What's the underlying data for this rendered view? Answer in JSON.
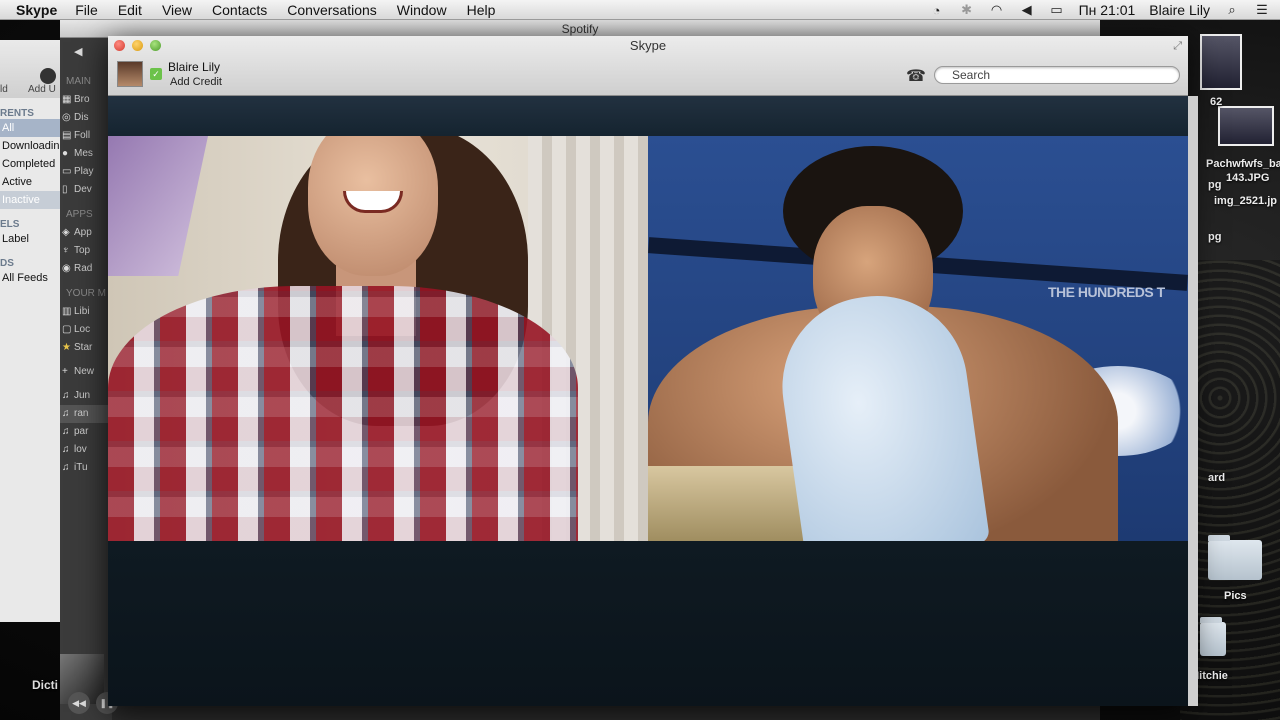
{
  "menubar": {
    "app": "Skype",
    "items": [
      "File",
      "Edit",
      "View",
      "Contacts",
      "Conversations",
      "Window",
      "Help"
    ],
    "clock": "Пн 21:01",
    "user": "Blaire Lily"
  },
  "torrent": {
    "toolbar_add": "Add U",
    "toolbar_d": "ld",
    "sections": {
      "torrents": "RENTS",
      "labels": "ELS",
      "feeds": "DS"
    },
    "rows": [
      "All",
      "Downloadin",
      "Completed",
      "Active",
      "Inactive"
    ],
    "label_row": "Label",
    "feeds_row": "All Feeds"
  },
  "spotify": {
    "title": "Spotify",
    "sections": {
      "main": "MAIN",
      "apps": "APPS",
      "your": "YOUR M"
    },
    "main_items": [
      "Bro",
      "Dis",
      "Foll",
      "Mes",
      "Play",
      "Dev"
    ],
    "app_items": [
      "App",
      "Top",
      "Rad"
    ],
    "your_items": [
      "Libi",
      "Loc",
      "Star"
    ],
    "new_item": "New",
    "playlists": [
      "Jun",
      "ran",
      "par",
      "lov",
      "iTu"
    ],
    "cover_label": "Dicti"
  },
  "skype": {
    "title": "Skype",
    "user_name": "Blaire Lily",
    "add_credit": "Add Credit",
    "search_placeholder": "Search",
    "poster_text": "THE HUNDREDS T"
  },
  "desktop": {
    "labels": [
      "62",
      "Pachwfwfs_ba",
      "143.JPG",
      "img_2521.jp",
      "pg",
      "pg",
      "ard",
      "Pics",
      "Mitchie"
    ]
  },
  "colors": {
    "skype_header": "#d9d9d9",
    "call_bg": "#0f1a22",
    "status_online": "#6cc24a"
  }
}
